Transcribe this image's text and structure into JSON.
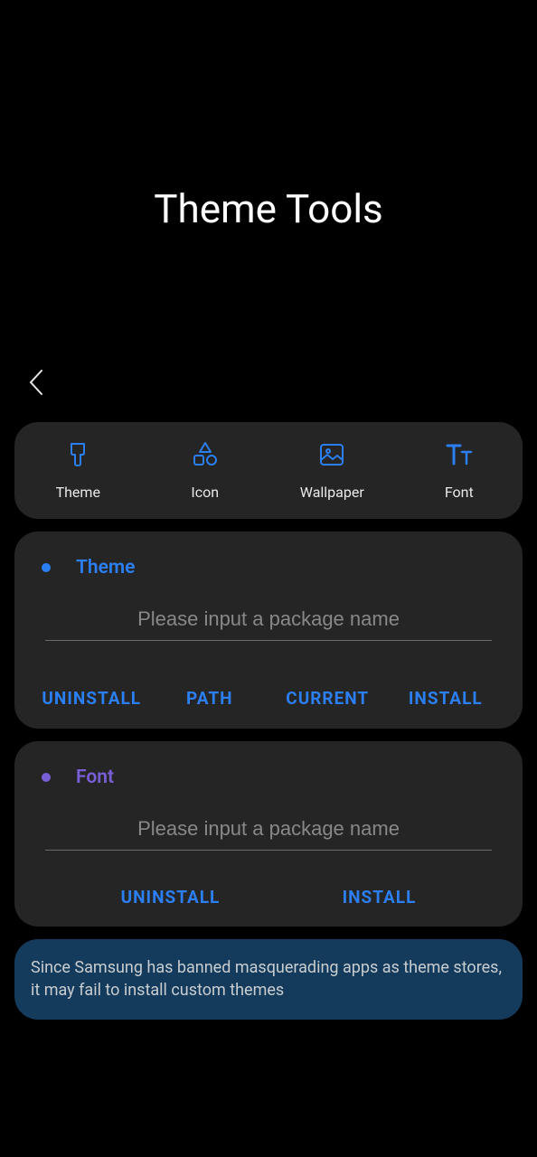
{
  "header": {
    "title": "Theme Tools"
  },
  "categories": [
    {
      "label": "Theme",
      "icon": "theme-icon"
    },
    {
      "label": "Icon",
      "icon": "icon-icon"
    },
    {
      "label": "Wallpaper",
      "icon": "wallpaper-icon"
    },
    {
      "label": "Font",
      "icon": "font-icon"
    }
  ],
  "theme_section": {
    "title": "Theme",
    "placeholder": "Please input a package name",
    "value": "",
    "buttons": {
      "uninstall": "UNINSTALL",
      "path": "PATH",
      "current": "CURRENT",
      "install": "INSTALL"
    }
  },
  "font_section": {
    "title": "Font",
    "placeholder": "Please input a package name",
    "value": "",
    "buttons": {
      "uninstall": "UNINSTALL",
      "install": "INSTALL"
    }
  },
  "notice": {
    "text": "Since Samsung has banned masquerading apps as theme stores, it may fail to install custom themes"
  },
  "colors": {
    "accent_blue": "#2b7ff2",
    "accent_purple": "#7a5ed6",
    "card_bg": "#252525",
    "notice_bg": "#143a5c"
  }
}
